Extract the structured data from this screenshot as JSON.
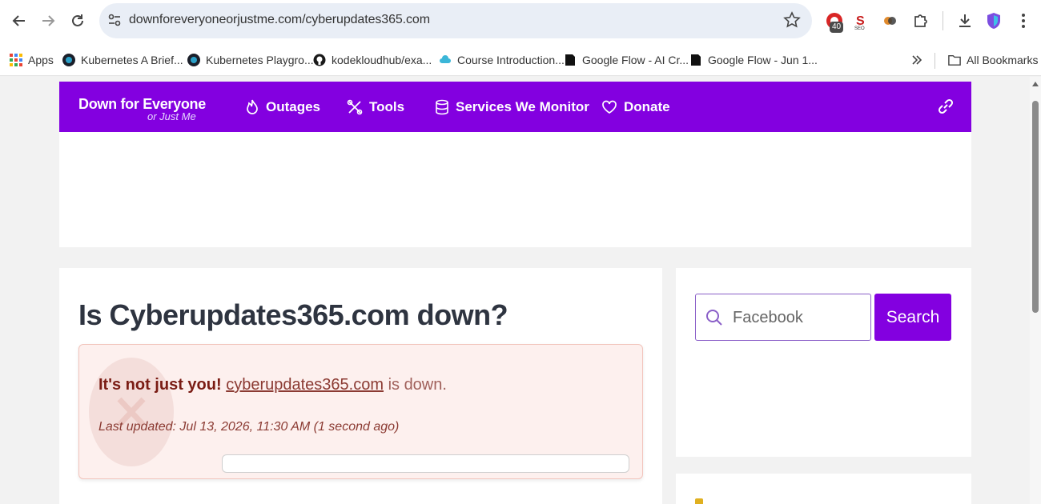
{
  "browser": {
    "url": "downforeveryoneorjustme.com/cyberupdates365.com",
    "extension_badge": "40",
    "bookmarks": [
      {
        "label": "Apps",
        "icon": "apps-grid-icon"
      },
      {
        "label": "Kubernetes A Brief...",
        "icon": "kubernetes-icon"
      },
      {
        "label": "Kubernetes Playgro...",
        "icon": "kubernetes-icon"
      },
      {
        "label": "kodekloudhub/exa...",
        "icon": "github-icon"
      },
      {
        "label": "Course Introduction...",
        "icon": "cloud-icon"
      },
      {
        "label": "Google Flow - AI Cr...",
        "icon": "flow-icon"
      },
      {
        "label": "Google Flow - Jun 1...",
        "icon": "flow-icon"
      }
    ],
    "all_bookmarks_label": "All Bookmarks"
  },
  "site": {
    "logo_main": "Down for Everyone",
    "logo_sub": "or Just Me",
    "nav": [
      {
        "label": "Outages",
        "icon": "fire-icon"
      },
      {
        "label": "Tools",
        "icon": "tools-icon"
      },
      {
        "label": "Services We Monitor",
        "icon": "database-icon"
      },
      {
        "label": "Donate",
        "icon": "heart-icon"
      }
    ]
  },
  "main": {
    "title": "Is Cyberupdates365.com down?",
    "status_bold": "It's not just you!",
    "status_domain": "cyberupdates365.com",
    "status_rest": "is down.",
    "last_updated": "Last updated: Jul 13, 2026, 11:30 AM (1 second ago)"
  },
  "sidebar": {
    "search_placeholder": "Facebook",
    "search_button": "Search"
  },
  "colors": {
    "brand": "#8300e0",
    "alert_bg": "#fdf0ee",
    "alert_text": "#7a1c14"
  }
}
